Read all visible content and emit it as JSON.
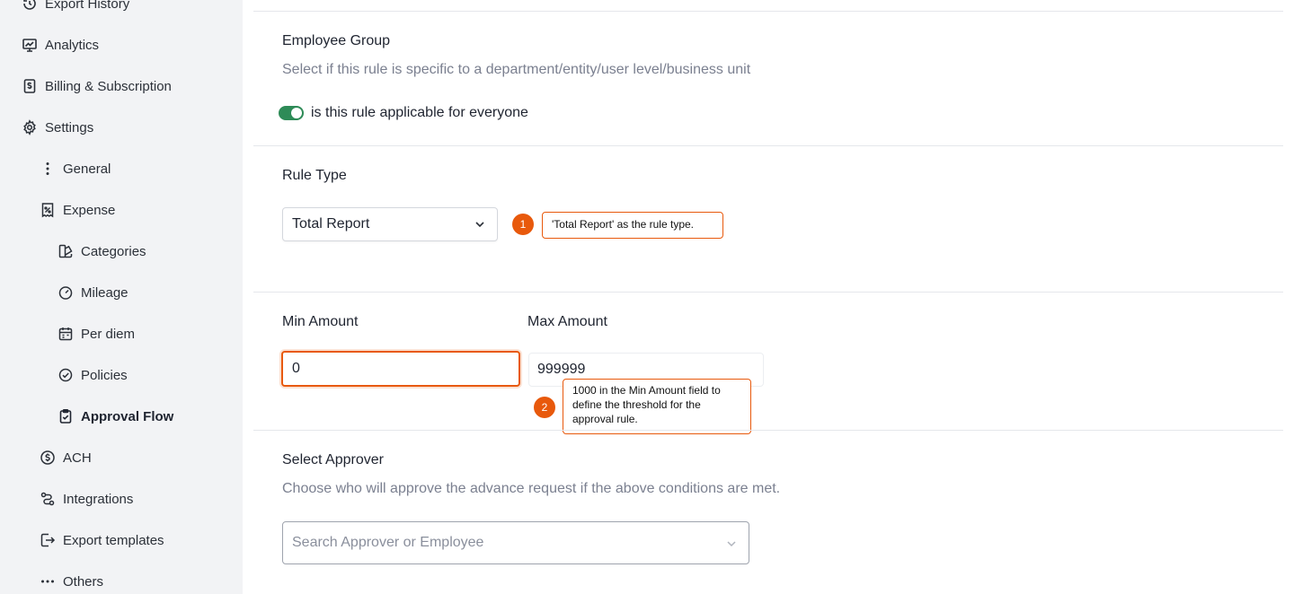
{
  "sidebar": {
    "items": [
      {
        "label": "Export History",
        "icon": "history-icon"
      },
      {
        "label": "Analytics",
        "icon": "chart-icon"
      },
      {
        "label": "Billing & Subscription",
        "icon": "billing-icon"
      },
      {
        "label": "Settings",
        "icon": "gear-icon"
      },
      {
        "label": "General",
        "icon": "vertical-dots-icon"
      },
      {
        "label": "Expense",
        "icon": "receipt-icon"
      },
      {
        "label": "Categories",
        "icon": "categories-icon"
      },
      {
        "label": "Mileage",
        "icon": "speedometer-icon"
      },
      {
        "label": "Per diem",
        "icon": "calendar-icon"
      },
      {
        "label": "Policies",
        "icon": "check-circle-icon"
      },
      {
        "label": "Approval Flow",
        "icon": "clipboard-check-icon"
      },
      {
        "label": "ACH",
        "icon": "dollar-circle-icon"
      },
      {
        "label": "Integrations",
        "icon": "integrations-icon"
      },
      {
        "label": "Export templates",
        "icon": "export-icon"
      },
      {
        "label": "Others",
        "icon": "horizontal-dots-icon"
      }
    ],
    "active": "Approval Flow"
  },
  "employee_group": {
    "title": "Employee Group",
    "description": "Select if this rule is specific to a department/entity/user level/business unit",
    "toggle_label": "is this rule applicable for everyone",
    "toggle_on": true
  },
  "rule_type": {
    "title": "Rule Type",
    "selected": "Total Report"
  },
  "amounts": {
    "min_label": "Min Amount",
    "min_value": "0",
    "max_label": "Max Amount",
    "max_value": "999999"
  },
  "approver": {
    "title": "Select Approver",
    "description": "Choose who will approve the advance request if the above conditions are met.",
    "placeholder": "Search Approver or Employee"
  },
  "annotations": [
    {
      "number": "1",
      "text": "'Total Report' as the rule type."
    },
    {
      "number": "2",
      "text": "1000 in the Min Amount field to define the threshold for the approval rule."
    }
  ],
  "colors": {
    "accent": "#e8590c",
    "toggle": "#2e8b57",
    "sidebar_bg": "#f2f3f5"
  }
}
